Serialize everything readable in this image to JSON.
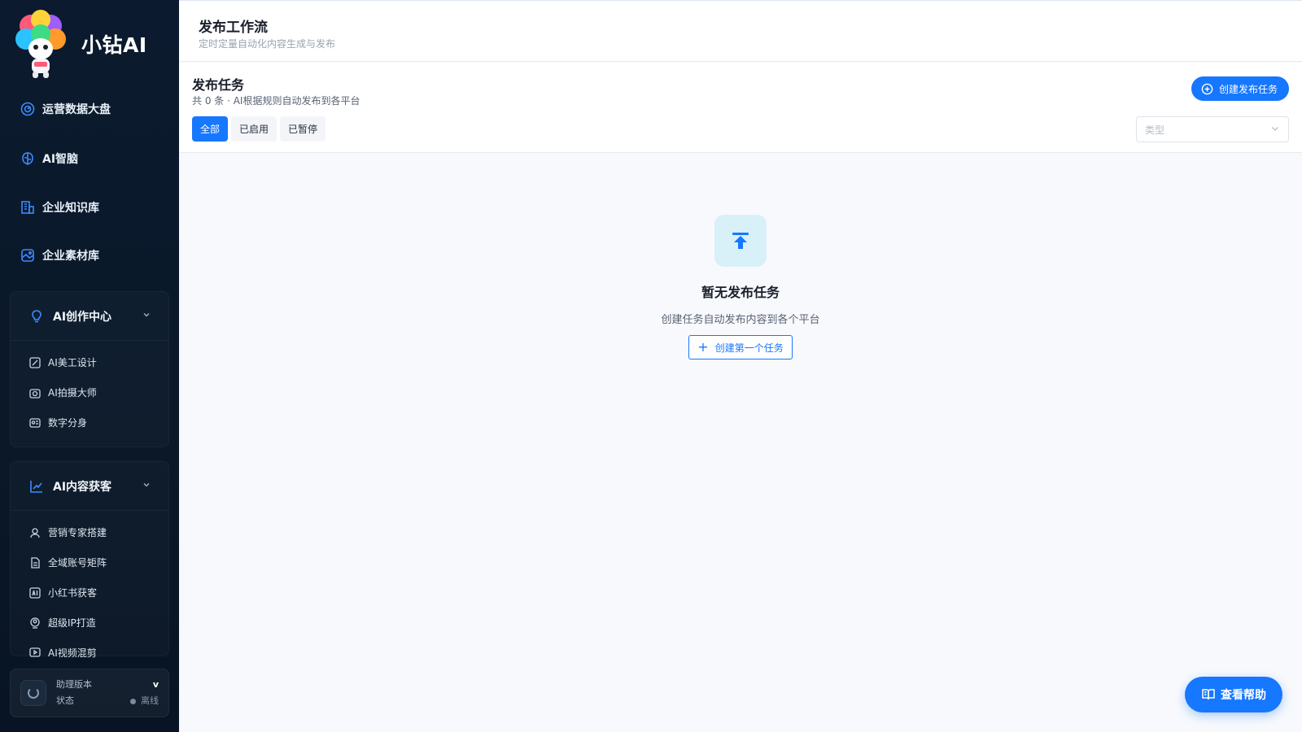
{
  "brand": {
    "name": "小钻AI",
    "logo_text": "小钻AI"
  },
  "sidebar": {
    "items": [
      {
        "label": "运营数据大盘",
        "icon": "dashboard-icon"
      },
      {
        "label": "AI智脑",
        "icon": "brain-icon"
      },
      {
        "label": "企业知识库",
        "icon": "building-icon"
      },
      {
        "label": "企业素材库",
        "icon": "image-icon"
      }
    ],
    "groups": [
      {
        "label": "AI创作中心",
        "icon": "bulb-icon",
        "items": [
          {
            "label": "AI美工设计",
            "icon": "design-icon"
          },
          {
            "label": "AI拍摄大师",
            "icon": "camera-icon"
          },
          {
            "label": "数字分身",
            "icon": "avatar-card-icon"
          }
        ]
      },
      {
        "label": "AI内容获客",
        "icon": "chart-icon",
        "items": [
          {
            "label": "营销专家搭建",
            "icon": "user-icon"
          },
          {
            "label": "全域账号矩阵",
            "icon": "document-icon"
          },
          {
            "label": "小红书获客",
            "icon": "ai-box-icon"
          },
          {
            "label": "超级IP打造",
            "icon": "ip-icon"
          },
          {
            "label": "AI视频混剪",
            "icon": "video-icon"
          }
        ]
      }
    ],
    "assistant": {
      "version_label": "助理版本",
      "version_value": "v",
      "status_label": "状态",
      "status_value": "离线"
    }
  },
  "header": {
    "title": "发布工作流",
    "subtitle": "定时定量自动化内容生成与发布"
  },
  "panel": {
    "title": "发布任务",
    "subtitle": "共 0 条 · AI根据规则自动发布到各平台",
    "create_label": "创建发布任务",
    "tabs": [
      {
        "label": "全部",
        "active": true
      },
      {
        "label": "已启用",
        "active": false
      },
      {
        "label": "已暂停",
        "active": false
      }
    ],
    "type_placeholder": "类型"
  },
  "empty": {
    "title": "暂无发布任务",
    "subtitle": "创建任务自动发布内容到各个平台",
    "button_label": "创建第一个任务"
  },
  "help": {
    "label": "查看帮助"
  },
  "colors": {
    "accent": "#1677ff",
    "sidebar_bg": "#0b1a2e",
    "empty_icon_bg": "#d8f0f7"
  }
}
